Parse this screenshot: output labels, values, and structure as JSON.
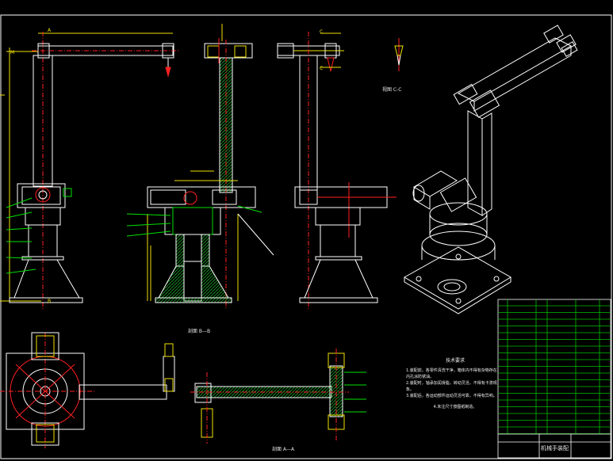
{
  "drawing": {
    "title_block_name": "机械手装配",
    "section_aa": "剖面 A—A",
    "section_bb": "剖面 B—B",
    "view_c": "视图 C-C",
    "tech_title": "技术要求",
    "tech_lines": [
      "1.装配前，各零件清洗干净，箱体内不得有杂物存在，内孔涂防锈油。",
      "2.装配时，轴承加润滑脂，转动灵活，不得有卡滞现象。",
      "3.装配后，各运动部件运动灵活可靠，不得有异响。"
    ],
    "tech_extra": "4.未注尺寸按图纸制造。",
    "labels": {
      "A": "A",
      "B": "B",
      "C": "C",
      "M": "M"
    }
  },
  "colors": {
    "line": "#ffffff",
    "red": "#ff2020",
    "yellow": "#f0e000",
    "green": "#00e000",
    "cyan": "#00d8d8",
    "hatch": "#1fa82a",
    "table": "#00c000"
  }
}
